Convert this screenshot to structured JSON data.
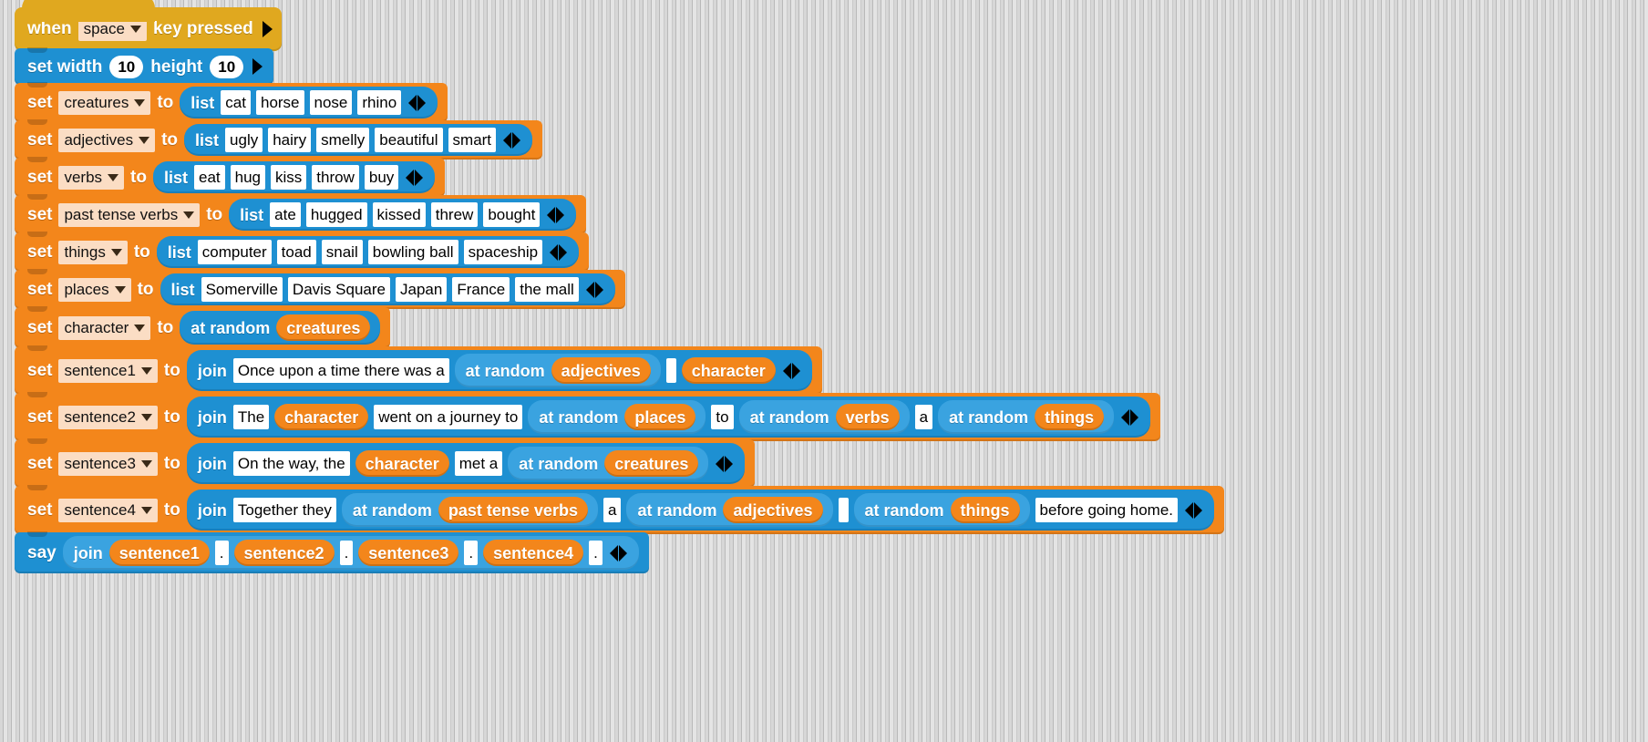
{
  "app": {
    "title": "Snap! block script editor",
    "background": "#e2e2e2",
    "colors": {
      "hat": "#e0a81f",
      "control_blue": "#1e90d2",
      "variables_orange": "#f3861b",
      "operators_light_blue": "#3aa3e0",
      "dropdown_bg": "#fbddc4",
      "slot_bg": "#ffffff"
    }
  },
  "script": {
    "hat": {
      "word_when": "when",
      "key": "space",
      "word_key_pressed": "key pressed",
      "icon": "right-arrow-icon"
    },
    "set_size": {
      "word_set_width": "set width",
      "width": "10",
      "word_height": "height",
      "height": "10"
    },
    "words": {
      "set": "set",
      "to": "to",
      "list": "list",
      "join": "join",
      "at_random": "at random",
      "say": "say"
    },
    "list_rows": [
      {
        "variable": "creatures",
        "items": [
          "cat",
          "horse",
          "nose",
          "rhino"
        ]
      },
      {
        "variable": "adjectives",
        "items": [
          "ugly",
          "hairy",
          "smelly",
          "beautiful",
          "smart"
        ]
      },
      {
        "variable": "verbs",
        "items": [
          "eat",
          "hug",
          "kiss",
          "throw",
          "buy"
        ]
      },
      {
        "variable": "past tense verbs",
        "items": [
          "ate",
          "hugged",
          "kissed",
          "threw",
          "bought"
        ]
      },
      {
        "variable": "things",
        "items": [
          "computer",
          "toad",
          "snail",
          "bowling ball",
          "spaceship"
        ]
      },
      {
        "variable": "places",
        "items": [
          "Somerville",
          "Davis Square",
          "Japan",
          "France",
          "the mall"
        ]
      }
    ],
    "set_character": {
      "variable": "character",
      "random_of": "creatures"
    },
    "sentence1": {
      "variable": "sentence1",
      "parts": [
        {
          "kind": "text",
          "value": "Once upon a time there was a"
        },
        {
          "kind": "random",
          "value": "adjectives"
        },
        {
          "kind": "text",
          "value": " "
        },
        {
          "kind": "var",
          "value": "character"
        }
      ]
    },
    "sentence2": {
      "variable": "sentence2",
      "parts": [
        {
          "kind": "text",
          "value": "The"
        },
        {
          "kind": "var",
          "value": "character"
        },
        {
          "kind": "text",
          "value": "went on a journey to"
        },
        {
          "kind": "random",
          "value": "places"
        },
        {
          "kind": "text",
          "value": "to"
        },
        {
          "kind": "random",
          "value": "verbs"
        },
        {
          "kind": "text",
          "value": "a"
        },
        {
          "kind": "random",
          "value": "things"
        }
      ]
    },
    "sentence3": {
      "variable": "sentence3",
      "parts": [
        {
          "kind": "text",
          "value": "On the way, the"
        },
        {
          "kind": "var",
          "value": "character"
        },
        {
          "kind": "text",
          "value": "met a"
        },
        {
          "kind": "random",
          "value": "creatures"
        }
      ]
    },
    "sentence4": {
      "variable": "sentence4",
      "parts": [
        {
          "kind": "text",
          "value": "Together they"
        },
        {
          "kind": "random",
          "value": "past tense verbs"
        },
        {
          "kind": "text",
          "value": "a"
        },
        {
          "kind": "random",
          "value": "adjectives"
        },
        {
          "kind": "text",
          "value": " "
        },
        {
          "kind": "random",
          "value": "things"
        },
        {
          "kind": "text",
          "value": "before going home."
        }
      ]
    },
    "say_row": {
      "parts": [
        {
          "kind": "var",
          "value": "sentence1"
        },
        {
          "kind": "text",
          "value": "."
        },
        {
          "kind": "var",
          "value": "sentence2"
        },
        {
          "kind": "text",
          "value": "."
        },
        {
          "kind": "var",
          "value": "sentence3"
        },
        {
          "kind": "text",
          "value": "."
        },
        {
          "kind": "var",
          "value": "sentence4"
        },
        {
          "kind": "text",
          "value": "."
        }
      ]
    }
  }
}
